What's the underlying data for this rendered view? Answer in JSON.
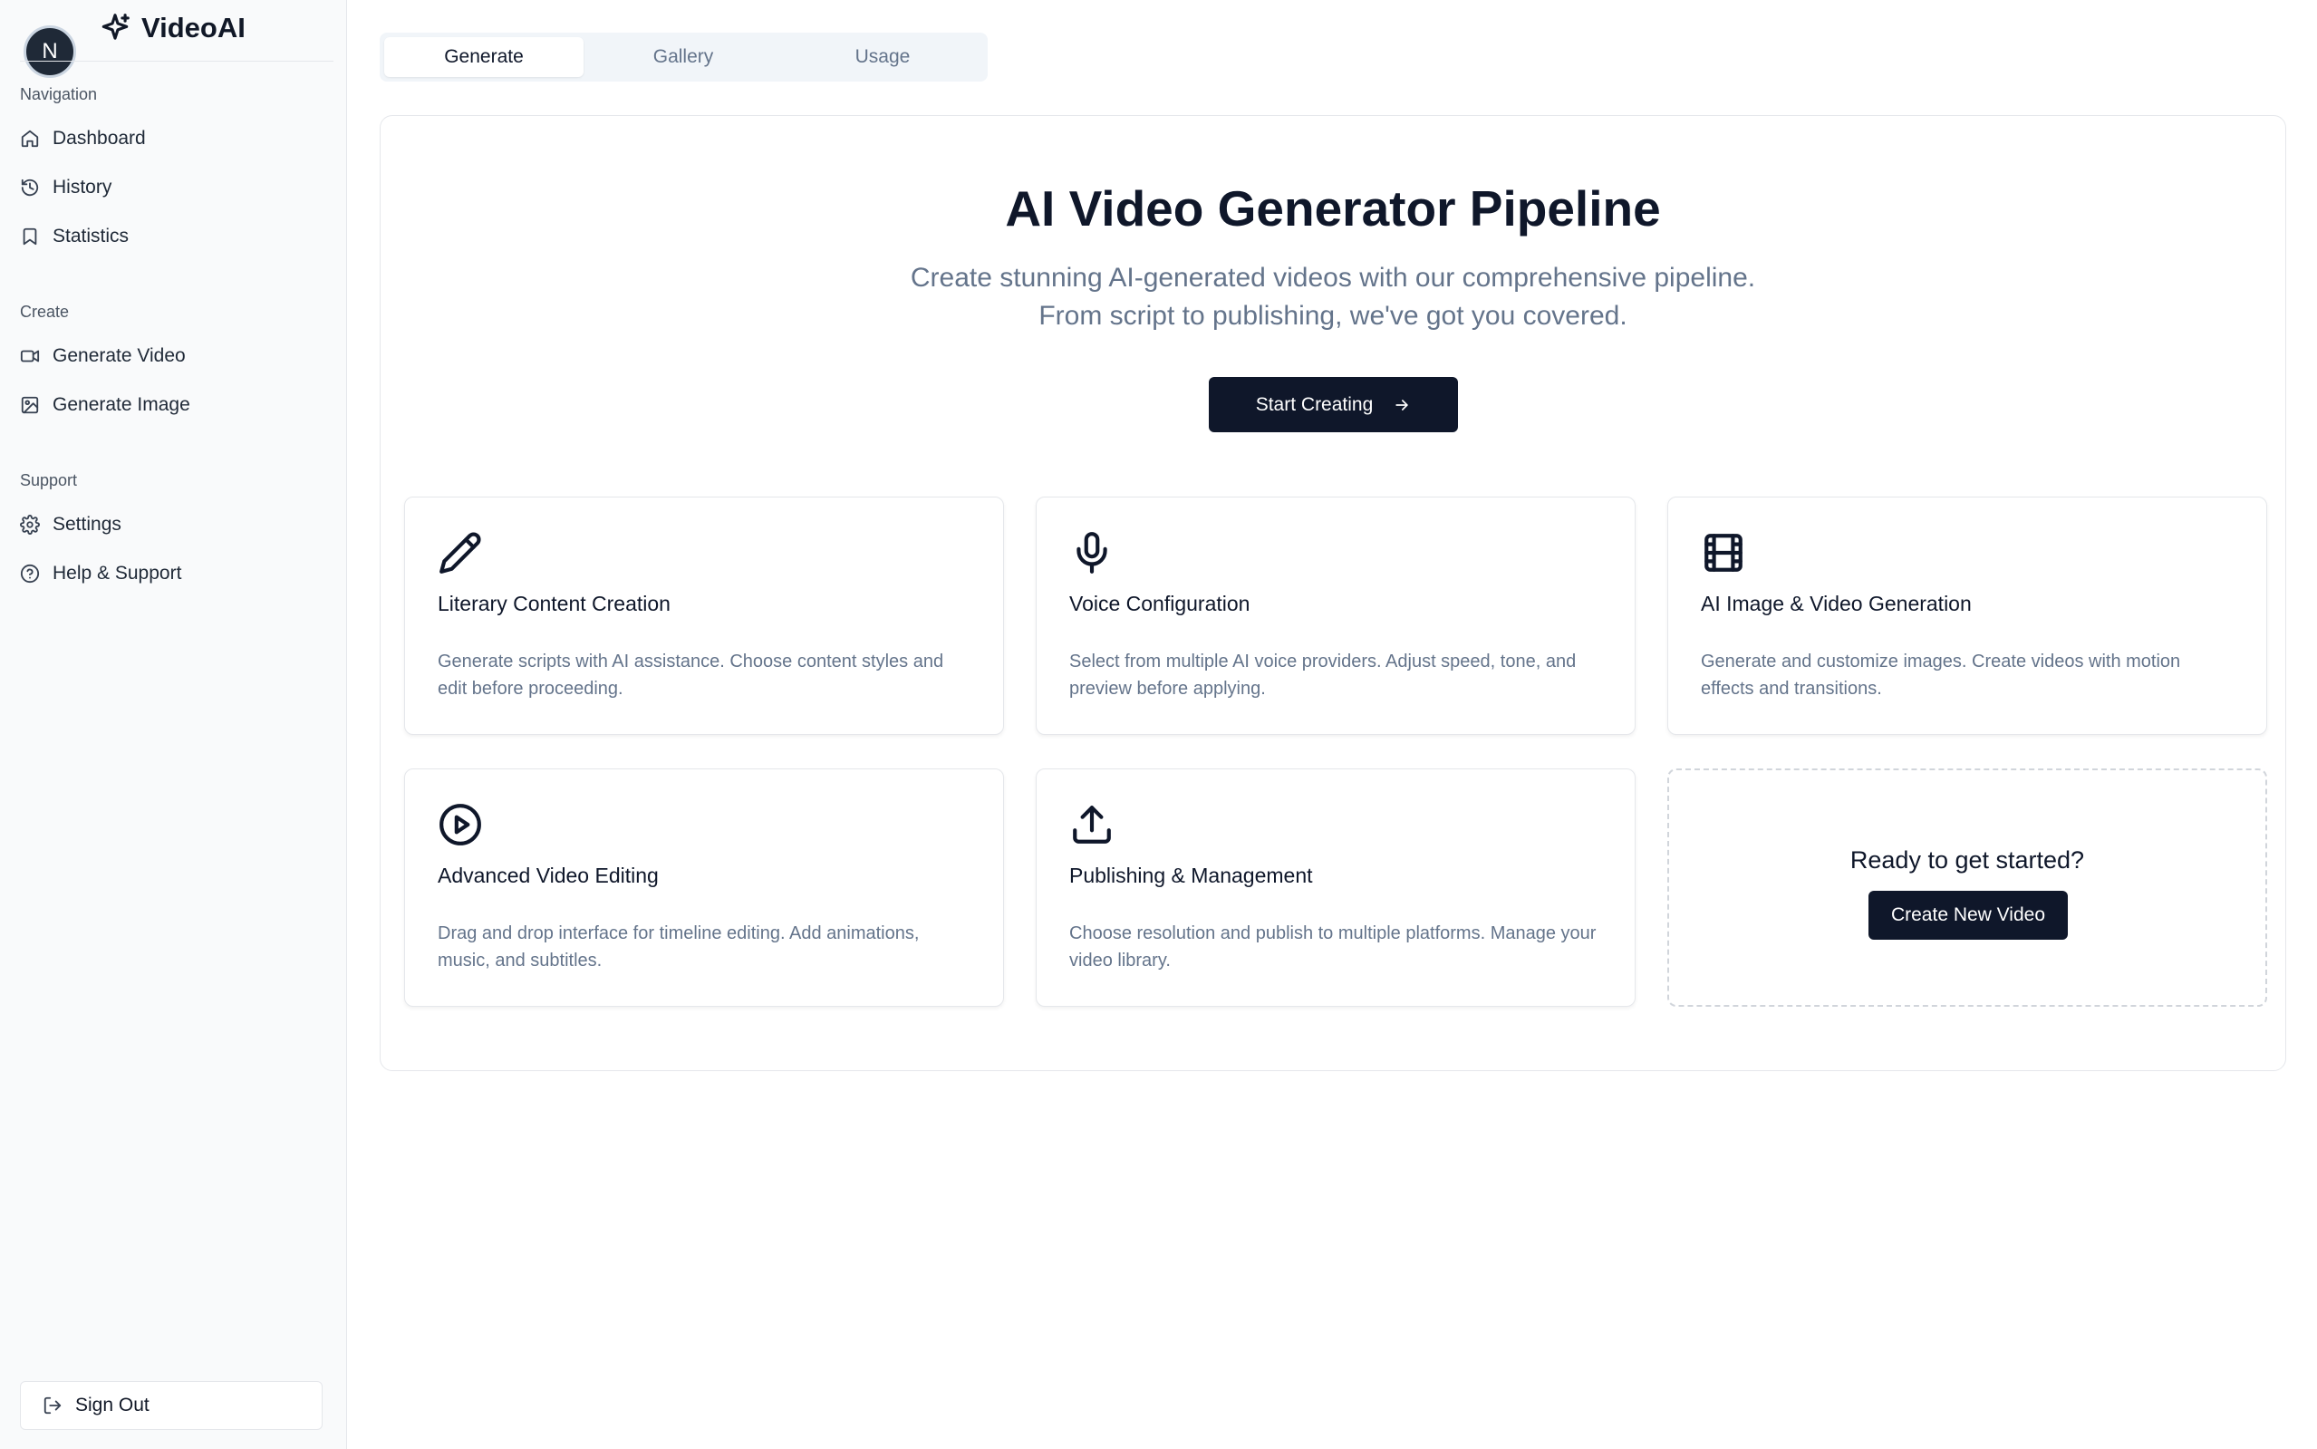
{
  "sidebar": {
    "avatar_initial": "N",
    "brand": "VideoAI",
    "sections": {
      "navigation": "Navigation",
      "create": "Create",
      "support": "Support"
    },
    "items": {
      "dashboard": "Dashboard",
      "history": "History",
      "statistics": "Statistics",
      "generate_video": "Generate Video",
      "generate_image": "Generate Image",
      "settings": "Settings",
      "help": "Help & Support"
    },
    "sign_out": "Sign Out"
  },
  "tabs": [
    {
      "label": "Generate",
      "active": true
    },
    {
      "label": "Gallery",
      "active": false
    },
    {
      "label": "Usage",
      "active": false
    }
  ],
  "hero": {
    "title": "AI Video Generator Pipeline",
    "subtitle_line1": "Create stunning AI-generated videos with our comprehensive pipeline.",
    "subtitle_line2": "From script to publishing, we've got you covered.",
    "cta_label": "Start Creating"
  },
  "features": [
    {
      "icon": "pencil-icon",
      "title": "Literary Content Creation",
      "desc": "Generate scripts with AI assistance. Choose content styles and edit before proceeding."
    },
    {
      "icon": "mic-icon",
      "title": "Voice Configuration",
      "desc": "Select from multiple AI voice providers. Adjust speed, tone, and preview before applying."
    },
    {
      "icon": "film-icon",
      "title": "AI Image & Video Generation",
      "desc": "Generate and customize images. Create videos with motion effects and transitions."
    },
    {
      "icon": "play-circle-icon",
      "title": "Advanced Video Editing",
      "desc": "Drag and drop interface for timeline editing. Add animations, music, and subtitles."
    },
    {
      "icon": "upload-icon",
      "title": "Publishing & Management",
      "desc": "Choose resolution and publish to multiple platforms. Manage your video library."
    }
  ],
  "cta_card": {
    "title": "Ready to get started?",
    "button": "Create New Video"
  },
  "colors": {
    "primary": "#0f172a",
    "muted_text": "#64748b",
    "sidebar_bg": "#f9fafb",
    "border": "#e5e7eb"
  }
}
